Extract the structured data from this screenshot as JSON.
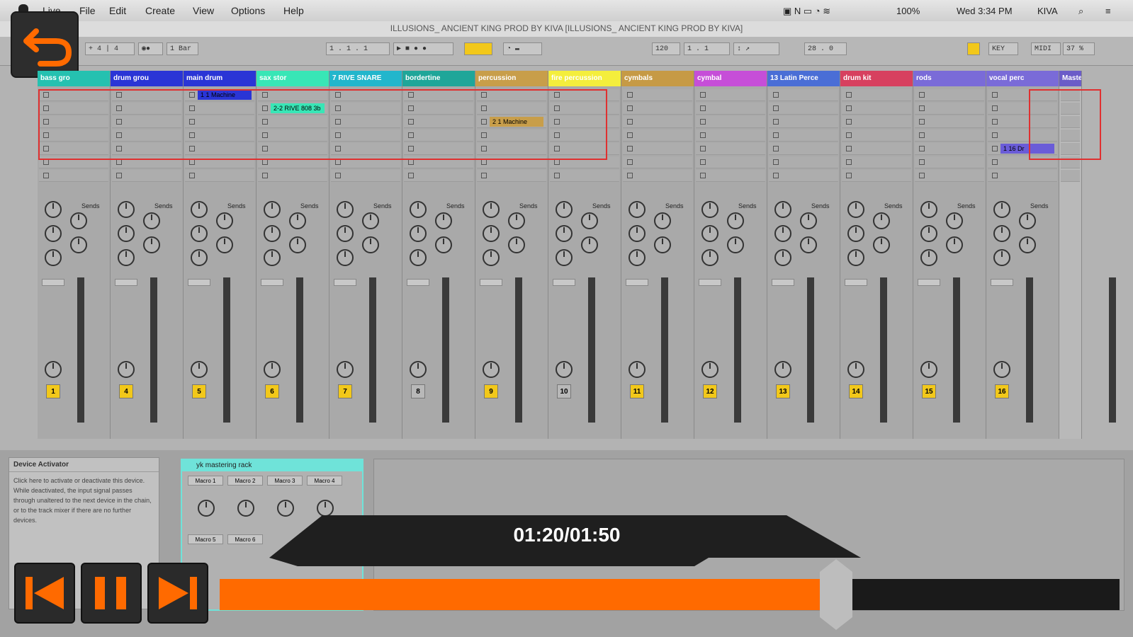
{
  "menubar": {
    "items": [
      "Live",
      "File",
      "Edit",
      "Create",
      "View",
      "Options",
      "Help"
    ],
    "battery": "100%",
    "clock": "Wed 3:34 PM",
    "user": "KIVA"
  },
  "window_title": "ILLUSIONS_ ANCIENT KING PROD BY KIVA  [ILLUSIONS_ ANCIENT KING PROD BY KIVA]",
  "transport": {
    "tempo": "120",
    "position": "1 . 1 . 1",
    "loop_length": "1 Bar",
    "key": "KEY",
    "midi": "MIDI",
    "cpu": "37 %",
    "end_pos": "28 . 0"
  },
  "tracks": [
    {
      "name": "bass gro",
      "color": "#25c1b0",
      "num": "1",
      "active": true
    },
    {
      "name": "drum grou",
      "color": "#2a35d6",
      "num": "4",
      "active": true
    },
    {
      "name": "main drum",
      "color": "#2a35d6",
      "num": "5",
      "active": true
    },
    {
      "name": "sax stor",
      "color": "#38e6b6",
      "num": "6",
      "active": true
    },
    {
      "name": "7 RIVE SNARE",
      "color": "#22b6cc",
      "num": "7",
      "active": true
    },
    {
      "name": "bordertine",
      "color": "#1fa699",
      "num": "8",
      "active": false
    },
    {
      "name": "percussion",
      "color": "#c89e4a",
      "num": "9",
      "active": true
    },
    {
      "name": "fire percussion",
      "color": "#f4ee3c",
      "num": "10",
      "active": false
    },
    {
      "name": "cymbals",
      "color": "#c69a45",
      "num": "11",
      "active": true
    },
    {
      "name": "cymbal",
      "color": "#c64ed8",
      "num": "12",
      "active": true
    },
    {
      "name": "13 Latin Perce",
      "color": "#4a6ed6",
      "num": "13",
      "active": true
    },
    {
      "name": "drum kit",
      "color": "#d7405f",
      "num": "14",
      "active": true
    },
    {
      "name": "rods",
      "color": "#7a6bd8",
      "num": "15",
      "active": true
    },
    {
      "name": "vocal perc",
      "color": "#7a6bd8",
      "num": "16",
      "active": true
    }
  ],
  "master": {
    "name": "Master",
    "color": "#6b5cc8"
  },
  "clips": [
    {
      "track": 2,
      "row": 0,
      "label": "1 1 Machine",
      "color": "#2a35d6"
    },
    {
      "track": 3,
      "row": 1,
      "label": "2-2 RIVE 808 3b",
      "color": "#38e6b6"
    },
    {
      "track": 6,
      "row": 2,
      "label": "2 1 Machine",
      "color": "#c89e4a"
    },
    {
      "track": 13,
      "row": 4,
      "label": "1 16 Dr",
      "color": "#6a5cd8"
    }
  ],
  "sends_label": "Sends",
  "device_info": {
    "title": "Device Activator",
    "body": "Click here to activate or deactivate this device. While deactivated, the input signal passes through unaltered to the next device in the chain, or to the track mixer if there are no further devices."
  },
  "device": {
    "title": "yk mastering rack",
    "macros": [
      "Macro 1",
      "Macro 2",
      "Macro 3",
      "Macro 4",
      "Macro 5",
      "Macro 6"
    ]
  },
  "player": {
    "time": "01:20/01:50",
    "progress": 0.685
  },
  "colors": {
    "accent": "#ff6a00",
    "highlight_box": "#e03030",
    "track_number": "#f2c81a"
  },
  "icons": [
    "undo-arrow-icon",
    "skip-back-icon",
    "pause-icon",
    "skip-forward-icon"
  ]
}
